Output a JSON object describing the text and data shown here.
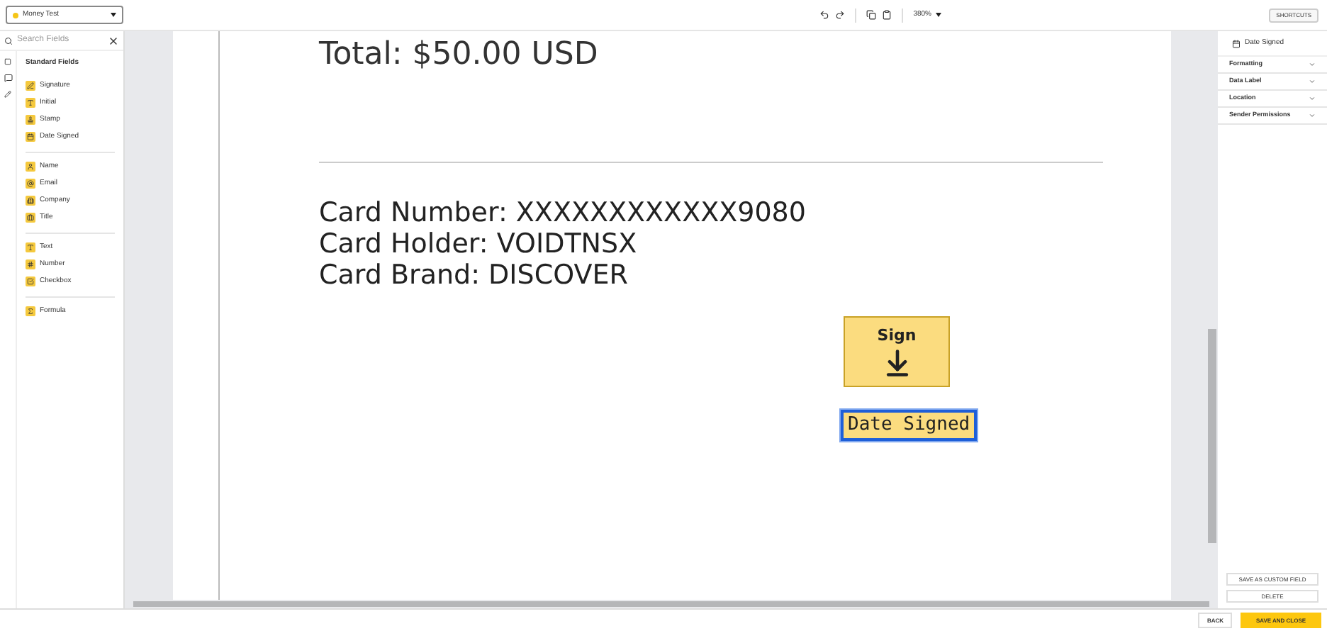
{
  "document_selector": {
    "value": "Money Test"
  },
  "toolbar": {
    "zoom": "380%",
    "shortcuts_button": "SHORTCUTS"
  },
  "sidebar": {
    "search": {
      "placeholder": "Search Fields"
    },
    "section_title": "Standard Fields",
    "groups": [
      {
        "items": [
          {
            "label": "Signature",
            "kind": "pen"
          },
          {
            "label": "Initial",
            "kind": "initial"
          },
          {
            "label": "Stamp",
            "kind": "stamp"
          },
          {
            "label": "Date Signed",
            "kind": "calendar"
          }
        ]
      },
      {
        "items": [
          {
            "label": "Name",
            "kind": "person"
          },
          {
            "label": "Email",
            "kind": "at"
          },
          {
            "label": "Company",
            "kind": "building"
          },
          {
            "label": "Title",
            "kind": "briefcase"
          }
        ]
      },
      {
        "items": [
          {
            "label": "Text",
            "kind": "text"
          },
          {
            "label": "Number",
            "kind": "number"
          },
          {
            "label": "Checkbox",
            "kind": "checkbox"
          }
        ]
      },
      {
        "items": [
          {
            "label": "Formula",
            "kind": "formula"
          }
        ]
      }
    ]
  },
  "document": {
    "total": "Total:  $50.00 USD",
    "card_lines": [
      "Card Number: XXXXXXXXXXXX9080",
      "Card Holder: VOIDTNSX",
      "Card Brand: DISCOVER"
    ],
    "fields": [
      {
        "kind": "sign",
        "label": "Sign",
        "selected": false
      },
      {
        "kind": "date",
        "label": "Date Signed",
        "selected": true
      }
    ]
  },
  "properties": {
    "title": "Date Signed",
    "sections": [
      {
        "label": "Formatting",
        "expanded": false
      },
      {
        "label": "Data Label",
        "expanded": false
      },
      {
        "label": "Location",
        "expanded": false
      },
      {
        "label": "Sender Permissions",
        "expanded": false
      }
    ],
    "buttons": [
      "SAVE AS CUSTOM FIELD",
      "DELETE"
    ]
  },
  "footer": {
    "back": "BACK",
    "save": "SAVE AND CLOSE"
  }
}
